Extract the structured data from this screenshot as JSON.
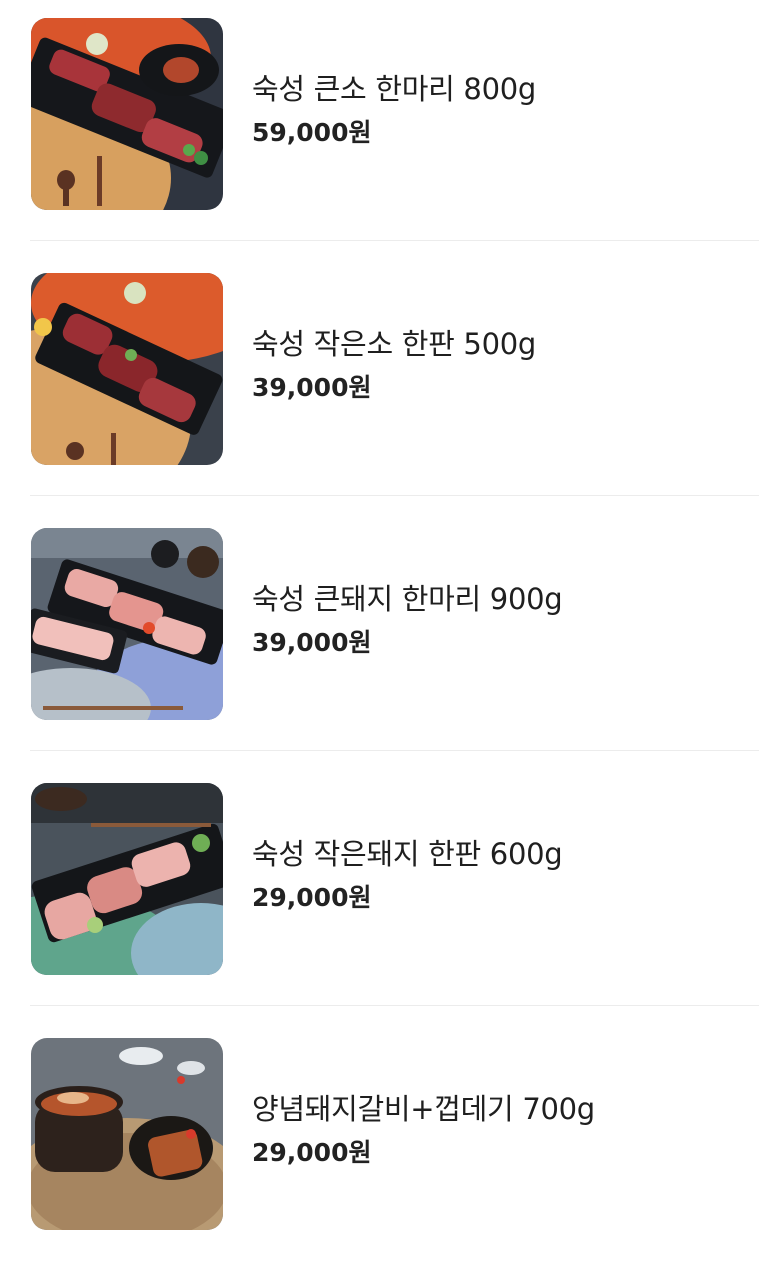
{
  "menu": {
    "items": [
      {
        "name": "숙성 큰소 한마리 800g",
        "price": "59,000원",
        "image": "beef-platter-large-photo"
      },
      {
        "name": "숙성 작은소 한판 500g",
        "price": "39,000원",
        "image": "beef-platter-small-photo"
      },
      {
        "name": "숙성 큰돼지 한마리 900g",
        "price": "39,000원",
        "image": "pork-platter-large-photo"
      },
      {
        "name": "숙성 작은돼지 한판 600g",
        "price": "29,000원",
        "image": "pork-platter-small-photo"
      },
      {
        "name": "양념돼지갈비+껍데기 700g",
        "price": "29,000원",
        "image": "marinated-pork-ribs-photo"
      }
    ]
  }
}
